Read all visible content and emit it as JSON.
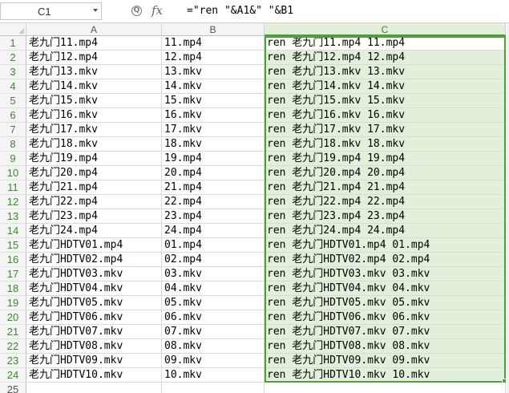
{
  "formula_bar": {
    "name_box": "C1",
    "fx_label": "fx",
    "formula": "=\"ren \"&A1&\" \"&B1"
  },
  "columns": [
    "A",
    "B",
    "C"
  ],
  "rows": [
    {
      "num": "1",
      "a": "老九门11.mp4",
      "b": "11.mp4",
      "c": "ren 老九门11.mp4 11.mp4"
    },
    {
      "num": "2",
      "a": "老九门12.mp4",
      "b": "12.mp4",
      "c": "ren 老九门12.mp4 12.mp4"
    },
    {
      "num": "3",
      "a": "老九门13.mkv",
      "b": "13.mkv",
      "c": "ren 老九门13.mkv 13.mkv"
    },
    {
      "num": "4",
      "a": "老九门14.mkv",
      "b": "14.mkv",
      "c": "ren 老九门14.mkv 14.mkv"
    },
    {
      "num": "5",
      "a": "老九门15.mkv",
      "b": "15.mkv",
      "c": "ren 老九门15.mkv 15.mkv"
    },
    {
      "num": "6",
      "a": "老九门16.mkv",
      "b": "16.mkv",
      "c": "ren 老九门16.mkv 16.mkv"
    },
    {
      "num": "7",
      "a": "老九门17.mkv",
      "b": "17.mkv",
      "c": "ren 老九门17.mkv 17.mkv"
    },
    {
      "num": "8",
      "a": "老九门18.mkv",
      "b": "18.mkv",
      "c": "ren 老九门18.mkv 18.mkv"
    },
    {
      "num": "9",
      "a": "老九门19.mp4",
      "b": "19.mp4",
      "c": "ren 老九门19.mp4 19.mp4"
    },
    {
      "num": "10",
      "a": "老九门20.mp4",
      "b": "20.mp4",
      "c": "ren 老九门20.mp4 20.mp4"
    },
    {
      "num": "11",
      "a": "老九门21.mp4",
      "b": "21.mp4",
      "c": "ren 老九门21.mp4 21.mp4"
    },
    {
      "num": "12",
      "a": "老九门22.mp4",
      "b": "22.mp4",
      "c": "ren 老九门22.mp4 22.mp4"
    },
    {
      "num": "13",
      "a": "老九门23.mp4",
      "b": "23.mp4",
      "c": "ren 老九门23.mp4 23.mp4"
    },
    {
      "num": "14",
      "a": "老九门24.mp4",
      "b": "24.mp4",
      "c": "ren 老九门24.mp4 24.mp4"
    },
    {
      "num": "15",
      "a": "老九门HDTV01.mp4",
      "b": "01.mp4",
      "c": "ren 老九门HDTV01.mp4 01.mp4"
    },
    {
      "num": "16",
      "a": "老九门HDTV02.mp4",
      "b": "02.mp4",
      "c": "ren 老九门HDTV02.mp4 02.mp4"
    },
    {
      "num": "17",
      "a": "老九门HDTV03.mkv",
      "b": "03.mkv",
      "c": "ren 老九门HDTV03.mkv 03.mkv"
    },
    {
      "num": "18",
      "a": "老九门HDTV04.mkv",
      "b": "04.mkv",
      "c": "ren 老九门HDTV04.mkv 04.mkv"
    },
    {
      "num": "19",
      "a": "老九门HDTV05.mkv",
      "b": "05.mkv",
      "c": "ren 老九门HDTV05.mkv 05.mkv"
    },
    {
      "num": "20",
      "a": "老九门HDTV06.mkv",
      "b": "06.mkv",
      "c": "ren 老九门HDTV06.mkv 06.mkv"
    },
    {
      "num": "21",
      "a": "老九门HDTV07.mkv",
      "b": "07.mkv",
      "c": "ren 老九门HDTV07.mkv 07.mkv"
    },
    {
      "num": "22",
      "a": "老九门HDTV08.mkv",
      "b": "08.mkv",
      "c": "ren 老九门HDTV08.mkv 08.mkv"
    },
    {
      "num": "23",
      "a": "老九门HDTV09.mkv",
      "b": "09.mkv",
      "c": "ren 老九门HDTV09.mkv 09.mkv"
    },
    {
      "num": "24",
      "a": "老九门HDTV10.mkv",
      "b": "10.mkv",
      "c": "ren 老九门HDTV10.mkv 10.mkv"
    },
    {
      "num": "25",
      "a": "",
      "b": "",
      "c": ""
    }
  ],
  "colors": {
    "selection_border": "#4aa03a",
    "selection_fill": "#e2efda",
    "header_selected_text": "#3a8a2c"
  }
}
